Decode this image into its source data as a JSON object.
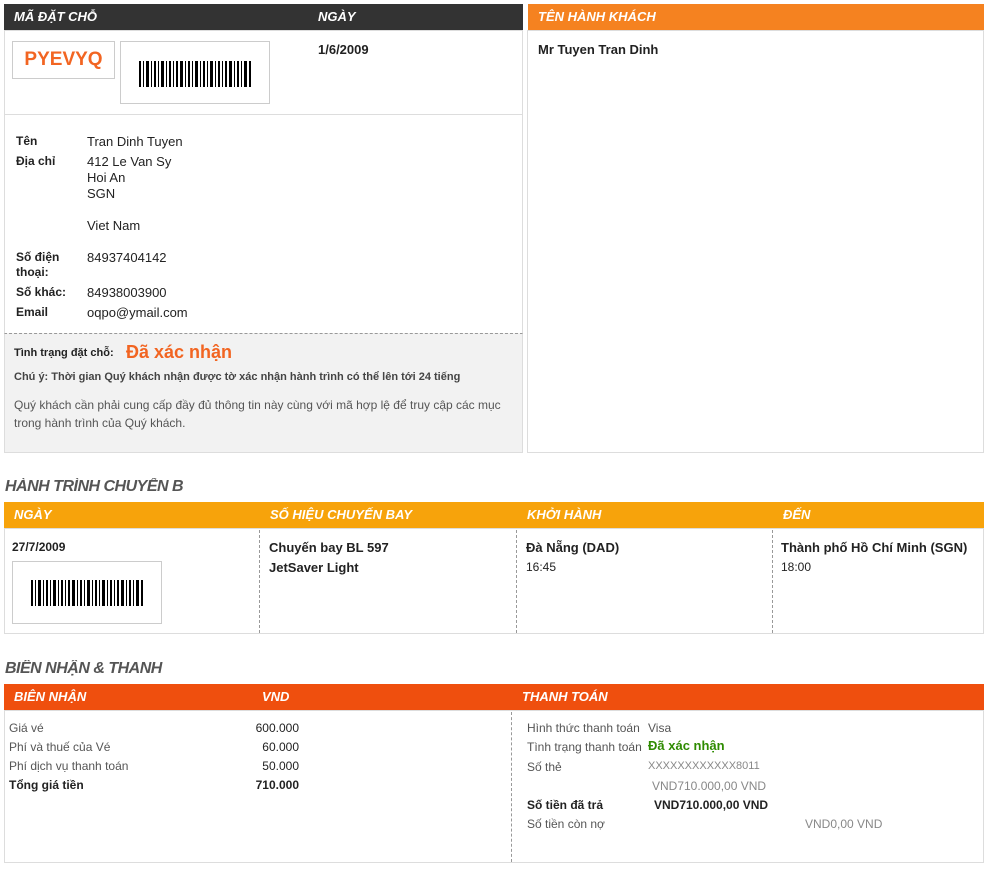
{
  "booking": {
    "code_header": "MÃ ĐẶT CHỖ",
    "date_header": "NGÀY",
    "passenger_header": "TÊN HÀNH KHÁCH",
    "code": "PYEVYQ",
    "date": "1/6/2009",
    "passenger_name": "Mr Tuyen Tran Dinh"
  },
  "contact": {
    "name_label": "Tên",
    "name": "Tran Dinh  Tuyen",
    "address_label": "Địa chỉ",
    "address_line1": "412 Le Van Sy",
    "address_line2": "Hoi An",
    "address_line3": "SGN",
    "address_line4": "Viet Nam",
    "phone_label_1": "Số điện",
    "phone_label_2": "thoại:",
    "phone": "84937404142",
    "other_label": "Số khác:",
    "other": "84938003900",
    "email_label": "Email",
    "email": "oqpo@ymail.com"
  },
  "status": {
    "label": "Tình trạng đặt chỗ:",
    "value": "Đã xác nhận",
    "note": "Chú ý: Thời gian Quý khách nhận được tờ xác nhận hành trình có thể lên tới 24 tiếng",
    "info_line1": "Quý khách cần phải cung cấp đầy đủ thông tin này cùng với mã hợp lệ để truy cập các mục",
    "info_line2": "trong hành trình của Quý khách."
  },
  "itinerary": {
    "title": "HÀNH TRÌNH CHUYẾN B",
    "col_date": "NGÀY",
    "col_flight": "SỐ HIỆU CHUYẾN BAY",
    "col_depart": "KHỞI HÀNH",
    "col_arrive": "ĐẾN",
    "date": "27/7/2009",
    "flight": "Chuyến bay BL  597",
    "fare": "JetSaver Light",
    "depart_place": "Đà Nẵng (DAD)",
    "depart_time": "16:45",
    "arrive_place": "Thành phố Hồ Chí Minh (SGN)",
    "arrive_time": "18:00"
  },
  "receipt": {
    "title": "BIÊN NHẬN & THANH",
    "col_receipt": "BIÊN NHẬN",
    "col_currency": "VND",
    "col_payment": "THANH TOÁN",
    "rows": [
      {
        "label": "Giá vé",
        "value": "600.000"
      },
      {
        "label": "Phí và thuế của Vé",
        "value": "60.000"
      },
      {
        "label": "Phí dịch vụ thanh toán",
        "value": "50.000"
      }
    ],
    "total_label": "Tổng giá tiền",
    "total_value": "710.000"
  },
  "payment": {
    "method_label": "Hình thức thanh toán",
    "method": "Visa",
    "status_label": "Tình trạng thanh toán",
    "status": "Đã xác nhận",
    "card_label": "Số thẻ",
    "card": "XXXXXXXXXXXX8011",
    "amount": "VND710.000,00  VND",
    "paid_label": "Số tiền đã trả",
    "paid": "VND710.000,00  VND",
    "due_label": "Số tiền còn nợ",
    "due": "VND0,00  VND"
  },
  "colors": {
    "accent": "#f58220",
    "itinerary": "#f7a30b",
    "receipt": "#ef4f0e",
    "status": "#f26522",
    "paid_status": "#2e8b00"
  }
}
